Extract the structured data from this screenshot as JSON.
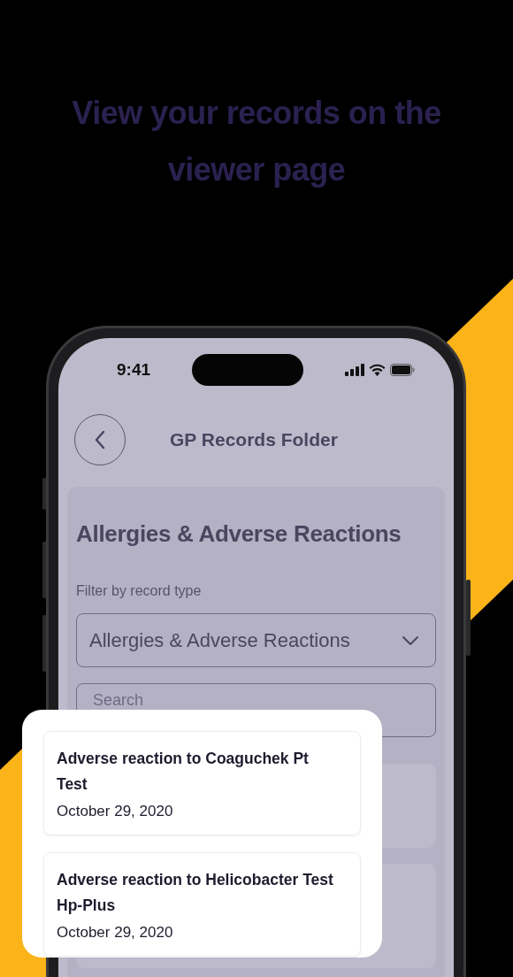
{
  "headline": [
    "View your records on the",
    "viewer page"
  ],
  "status_bar": {
    "time": "9:41"
  },
  "header": {
    "title": "GP Records Folder"
  },
  "section": {
    "title": "Allergies & Adverse Reactions",
    "filter_label": "Filter by record type",
    "filter_value": "Allergies & Adverse Reactions",
    "search": {
      "placeholder": "Search"
    }
  },
  "records": [
    {
      "title": "Adverse reaction to Coaguchek Pt Test",
      "date": "October 29, 2020"
    },
    {
      "title": "Adverse reaction to Helicobacter Test Hp-Plus",
      "date": "October 29, 2020"
    }
  ]
}
